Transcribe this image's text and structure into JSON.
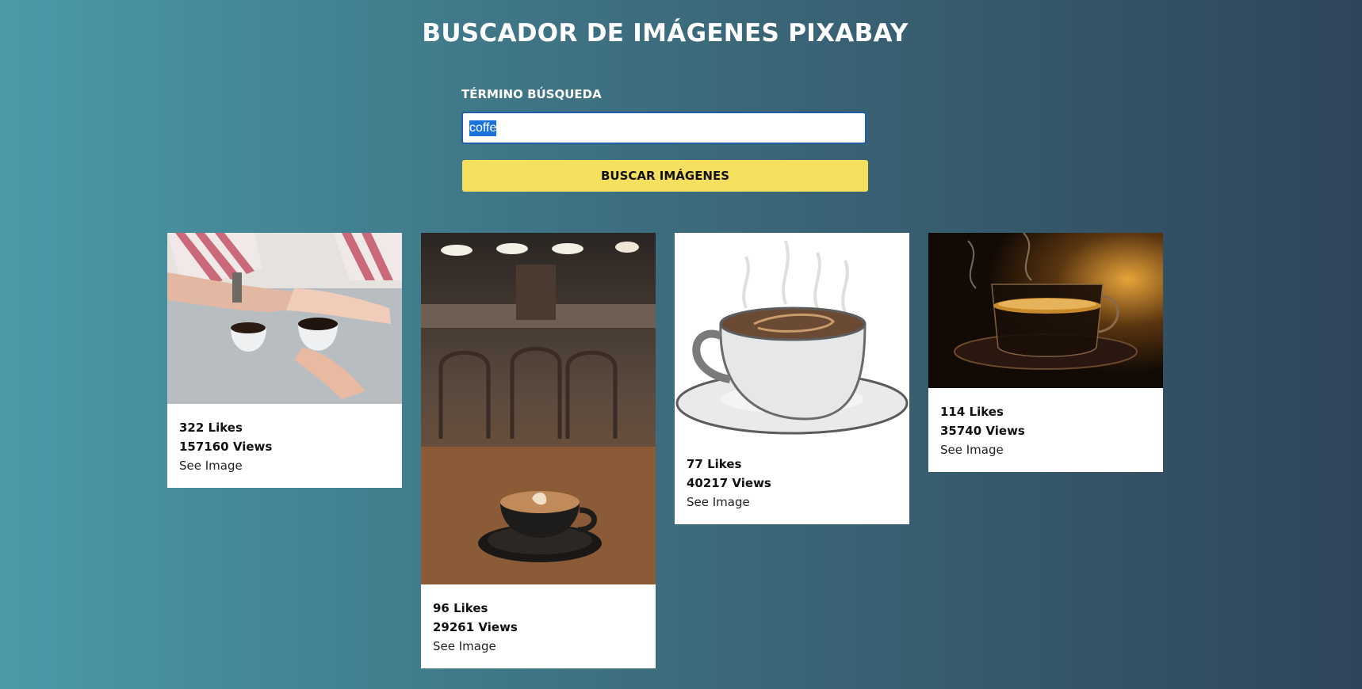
{
  "header": {
    "title": "BUSCADOR DE IMÁGENES PIXABAY"
  },
  "form": {
    "label": "TÉRMINO BÚSQUEDA",
    "search_value": "coffe",
    "button_label": "BUSCAR IMÁGENES"
  },
  "results": [
    {
      "likes": "322 Likes",
      "views": "157160 Views",
      "link": "See Image",
      "image": "couple-holding-hands-coffee-cups"
    },
    {
      "likes": "96 Likes",
      "views": "29261 Views",
      "link": "See Image",
      "image": "latte-in-cafe"
    },
    {
      "likes": "77 Likes",
      "views": "40217 Views",
      "link": "See Image",
      "image": "coffee-cup-illustration"
    },
    {
      "likes": "114 Likes",
      "views": "35740 Views",
      "link": "See Image",
      "image": "espresso-glass-cup"
    }
  ],
  "colors": {
    "accent_button": "#f5df5e",
    "selection": "#1a73d9"
  }
}
